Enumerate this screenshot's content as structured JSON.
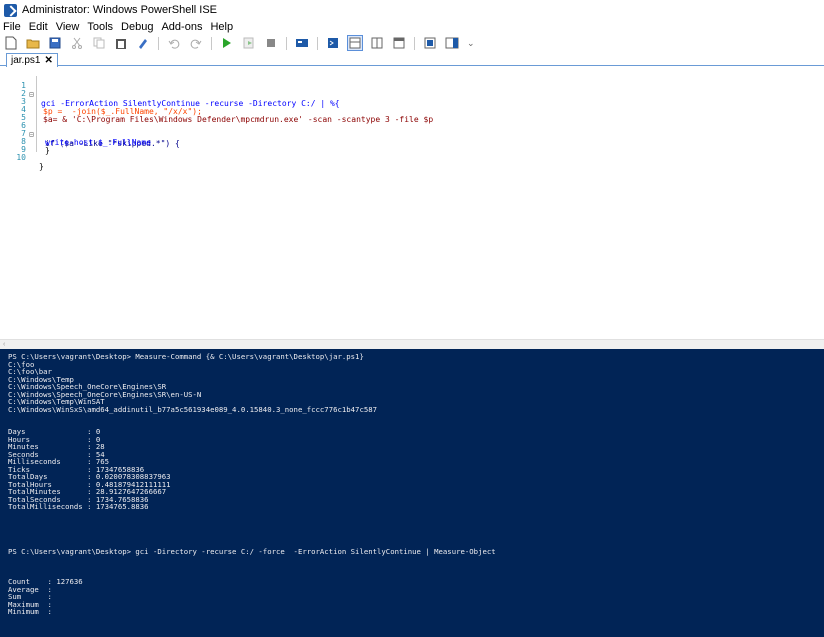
{
  "window": {
    "title": "Administrator: Windows PowerShell ISE"
  },
  "menu": [
    "File",
    "Edit",
    "View",
    "Tools",
    "Debug",
    "Add-ons",
    "Help"
  ],
  "toolbar": {
    "overflow": "⌄"
  },
  "tab": {
    "label": "jar.ps1",
    "close": "✕"
  },
  "editor": {
    "lines": [
      {
        "n": "1",
        "fold": "⊟",
        "text": "gci -ErrorAction SilentlyContinue -recurse -Directory C:/ | %{"
      },
      {
        "n": "2",
        "fold": "",
        "text": "$p =  -join($_.FullName, \"/x/x\");"
      },
      {
        "n": "3",
        "fold": "",
        "text": "$a= & 'C:\\Program Files\\Windows Defender\\mpcmdrun.exe' -scan -scantype 3 -file $p"
      },
      {
        "n": "4",
        "fold": "",
        "text": ""
      },
      {
        "n": "5",
        "fold": "",
        "text": ""
      },
      {
        "n": "6",
        "fold": "⊟",
        "text": "if ($a -Like \"*skipped.*\") {"
      },
      {
        "n": "7",
        "fold": "",
        "text": "write-host $_.FullName"
      },
      {
        "n": "8",
        "fold": "",
        "text": "}"
      },
      {
        "n": "9",
        "fold": "",
        "text": ""
      },
      {
        "n": "10",
        "fold": "",
        "text": "}"
      }
    ]
  },
  "console": {
    "lines": [
      "PS C:\\Users\\vagrant\\Desktop> Measure-Command {& C:\\Users\\vagrant\\Desktop\\jar.ps1}",
      "C:\\foo",
      "C:\\foo\\bar",
      "C:\\Windows\\Temp",
      "C:\\Windows\\Speech_OneCore\\Engines\\SR",
      "C:\\Windows\\Speech_OneCore\\Engines\\SR\\en-US-N",
      "C:\\Windows\\Temp\\WinSAT",
      "C:\\Windows\\WinSxS\\amd64_addinutil_b77a5c561934e089_4.0.15840.3_none_fccc776c1b47c587",
      "",
      "",
      "Days              : 0",
      "Hours             : 0",
      "Minutes           : 28",
      "Seconds           : 54",
      "Milliseconds      : 765",
      "Ticks             : 17347658836",
      "TotalDays         : 0.020078308837963",
      "TotalHours        : 0.481879412111111",
      "TotalMinutes      : 28.9127647266667",
      "TotalSeconds      : 1734.7658836",
      "TotalMilliseconds : 1734765.8836",
      "",
      "",
      "",
      "",
      "",
      "PS C:\\Users\\vagrant\\Desktop> gci -Directory -recurse C:/ -force  -ErrorAction SilentlyContinue | Measure-Object",
      "",
      "",
      "",
      "Count    : 127636",
      "Average  :",
      "Sum      :",
      "Maximum  :",
      "Minimum  :"
    ]
  }
}
